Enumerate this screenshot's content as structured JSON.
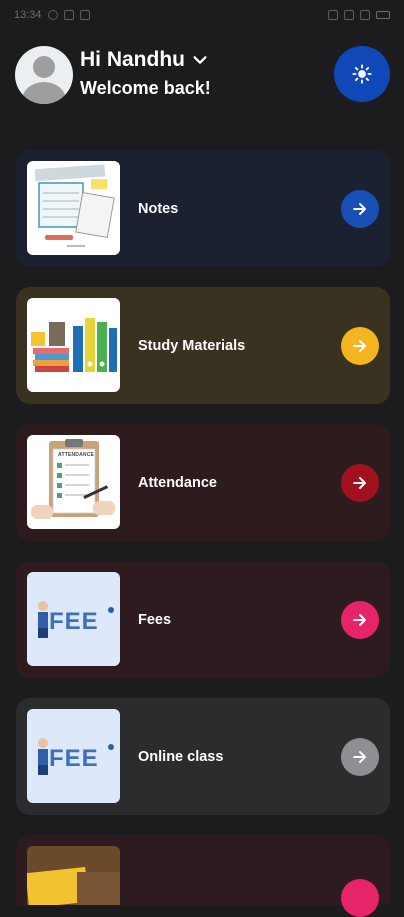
{
  "status_bar": {
    "time": "13:34"
  },
  "header": {
    "greeting": "Hi Nandhu",
    "welcome": "Welcome back!"
  },
  "cards": [
    {
      "label": "Notes",
      "bg": "#1b2131",
      "accent": "#1a4fb5",
      "icon": "notes-thumbnail"
    },
    {
      "label": "Study Materials",
      "bg": "#3a3220",
      "accent": "#f5b521",
      "icon": "study-materials-thumbnail"
    },
    {
      "label": "Attendance",
      "bg": "#2e1b1e",
      "accent": "#a31121",
      "icon": "attendance-thumbnail"
    },
    {
      "label": "Fees",
      "bg": "#2e1b20",
      "accent": "#e7246a",
      "icon": "fees-thumbnail"
    },
    {
      "label": "Online class",
      "bg": "#2c2c2e",
      "accent": "#8e8e93",
      "icon": "online-class-thumbnail"
    },
    {
      "label": "",
      "bg": "#2e1b20",
      "accent": "#e7246a",
      "icon": "partial-card-thumbnail"
    }
  ],
  "thumb_text": {
    "attendance": "ATTENDANCE",
    "fee": "FEE"
  },
  "colors": {
    "background": "#1c1c1e",
    "theme_button": "#1148b8"
  }
}
